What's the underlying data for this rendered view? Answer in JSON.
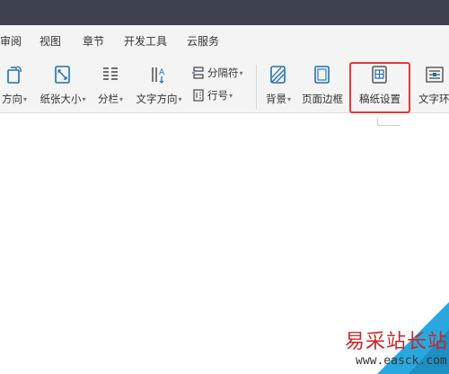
{
  "menu": {
    "items": [
      {
        "label": "审阅"
      },
      {
        "label": "视图"
      },
      {
        "label": "章节"
      },
      {
        "label": "开发工具"
      },
      {
        "label": "云服务"
      }
    ]
  },
  "ribbon": {
    "orientation_label": "方向",
    "paper_size_label": "纸张大小",
    "columns_label": "分栏",
    "text_direction_label": "文字方向",
    "separator_label": "分隔符",
    "line_number_label": "行号",
    "background_label": "背景",
    "page_border_label": "页面边框",
    "manuscript_settings_label": "稿纸设置",
    "text_wrap_label": "文字环"
  },
  "watermark": {
    "site_name": "易采站长站",
    "url": "www.easck.com"
  },
  "colors": {
    "highlight": "#e53935",
    "titlebar": "#3d4150",
    "watermark_text": "#c62828",
    "watermark_triangle": "#29a8e0"
  }
}
